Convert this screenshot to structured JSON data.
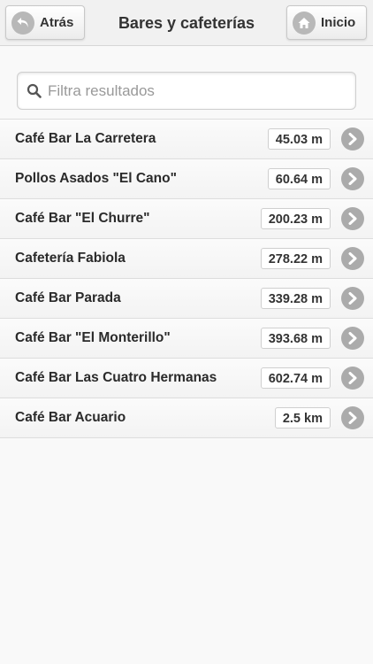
{
  "header": {
    "title": "Bares y cafeterías",
    "back_label": "Atrás",
    "home_label": "Inicio"
  },
  "search": {
    "placeholder": "Filtra resultados",
    "value": ""
  },
  "results": [
    {
      "name": "Café Bar La Carretera",
      "distance": "45.03 m"
    },
    {
      "name": "Pollos Asados \"El Cano\"",
      "distance": "60.64 m"
    },
    {
      "name": "Café Bar \"El Churre\"",
      "distance": "200.23 m"
    },
    {
      "name": "Cafetería Fabiola",
      "distance": "278.22 m"
    },
    {
      "name": "Café Bar Parada",
      "distance": "339.28 m"
    },
    {
      "name": "Café Bar \"El Monterillo\"",
      "distance": "393.68 m"
    },
    {
      "name": "Café Bar Las Cuatro Hermanas",
      "distance": "602.74 m"
    },
    {
      "name": "Café Bar Acuario",
      "distance": "2.5 km"
    }
  ],
  "icons": {
    "back": "back-arrow-icon",
    "home": "home-icon",
    "search": "search-icon",
    "row": "chevron-right-icon"
  },
  "colors": {
    "background": "#f9f9f9",
    "header": "#f1f1f1",
    "icon_gray": "#b0b0b0"
  }
}
